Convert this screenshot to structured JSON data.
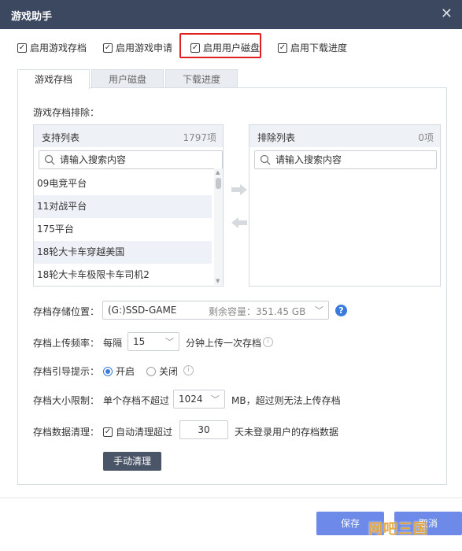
{
  "window": {
    "title": "游戏助手",
    "close_glyph": "✕"
  },
  "top_options": [
    {
      "label": "启用游戏存档",
      "checked": true
    },
    {
      "label": "启用游戏申请",
      "checked": true
    },
    {
      "label": "启用用户磁盘",
      "checked": true
    },
    {
      "label": "启用下载进度",
      "checked": true
    }
  ],
  "tabs": [
    {
      "label": "游戏存档",
      "active": true
    },
    {
      "label": "用户磁盘",
      "active": false
    },
    {
      "label": "下载进度",
      "active": false
    }
  ],
  "exclusion": {
    "section_label": "游戏存档排除：",
    "supported": {
      "title": "支持列表",
      "count": "1797项",
      "search_placeholder": "请输入搜索内容",
      "items": [
        "09电竞平台",
        "11对战平台",
        "175平台",
        "18轮大卡车穿越美国",
        "18轮大卡车极限卡车司机2"
      ]
    },
    "excluded": {
      "title": "排除列表",
      "count": "0项",
      "search_placeholder": "请输入搜索内容"
    }
  },
  "storage_location": {
    "label": "存档存储位置：",
    "value": "(G:)SSD-GAME",
    "free_space": "剩余容量：351.45 GB",
    "help_glyph": "?"
  },
  "upload_frequency": {
    "label": "存档上传频率：",
    "prefix": "每隔",
    "value": "15",
    "suffix": "分钟上传一次存档"
  },
  "guide_prompt": {
    "label": "存档引导提示：",
    "on_label": "开启",
    "off_label": "关闭",
    "selected": "开启"
  },
  "size_limit": {
    "label": "存档大小限制：",
    "prefix": "单个存档不超过",
    "value": "1024",
    "suffix": "MB，超过则无法上传存档"
  },
  "cleanup": {
    "label": "存档数据清理：",
    "checkbox_label": "自动清理超过",
    "checked": true,
    "days": "30",
    "suffix": "天未登录用户的存档数据",
    "manual_button": "手动清理"
  },
  "footer": {
    "save_label": "保存",
    "cancel_label": "取消"
  },
  "watermark": "网吧三国",
  "colors": {
    "titlebar": "#3c4860",
    "accent": "#3b7be0",
    "primary_button": "#6d8ae8",
    "highlight_box": "#e02020"
  }
}
